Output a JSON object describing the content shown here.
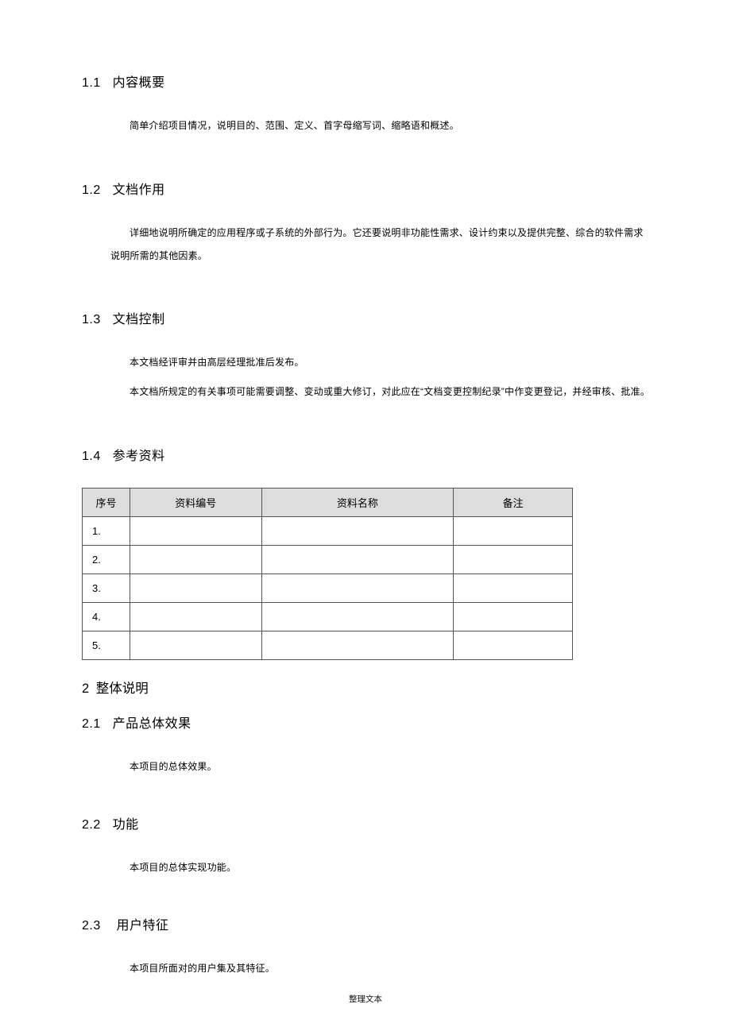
{
  "sections": {
    "s1_1": {
      "num": "1.1",
      "title": "内容概要",
      "p1": "简单介绍项目情况，说明目的、范围、定义、首字母缩写词、缩略语和概述。"
    },
    "s1_2": {
      "num": "1.2",
      "title": "文档作用",
      "p1": "详细地说明所确定的应用程序或子系统的外部行为。它还要说明非功能性需求、设计约束以及提供完整、综合的软件需求说明所需的其他因素。"
    },
    "s1_3": {
      "num": "1.3",
      "title": "文档控制",
      "p1": "本文档经评审并由高层经理批准后发布。",
      "p2": "本文档所规定的有关事项可能需要调整、变动或重大修订，对此应在“文档变更控制纪录”中作变更登记，并经审核、批准。"
    },
    "s1_4": {
      "num": "1.4",
      "title": "参考资料"
    },
    "s2": {
      "num": "2",
      "title": "整体说明"
    },
    "s2_1": {
      "num": "2.1",
      "title": "产品总体效果",
      "p1": "本项目的总体效果。"
    },
    "s2_2": {
      "num": "2.2",
      "title": "功能",
      "p1": "本项目的总体实现功能。"
    },
    "s2_3": {
      "num": "2.3",
      "title": "用户特征",
      "p1": "本项目所面对的用户集及其特征。"
    }
  },
  "table": {
    "headers": {
      "h1": "序号",
      "h2": "资料编号",
      "h3": "资料名称",
      "h4": "备注"
    },
    "rows": [
      {
        "n": "1.",
        "code": "",
        "name": "",
        "note": ""
      },
      {
        "n": "2.",
        "code": "",
        "name": "",
        "note": ""
      },
      {
        "n": "3.",
        "code": "",
        "name": "",
        "note": ""
      },
      {
        "n": "4.",
        "code": "",
        "name": "",
        "note": ""
      },
      {
        "n": "5.",
        "code": "",
        "name": "",
        "note": ""
      }
    ]
  },
  "footer": "整理文本"
}
